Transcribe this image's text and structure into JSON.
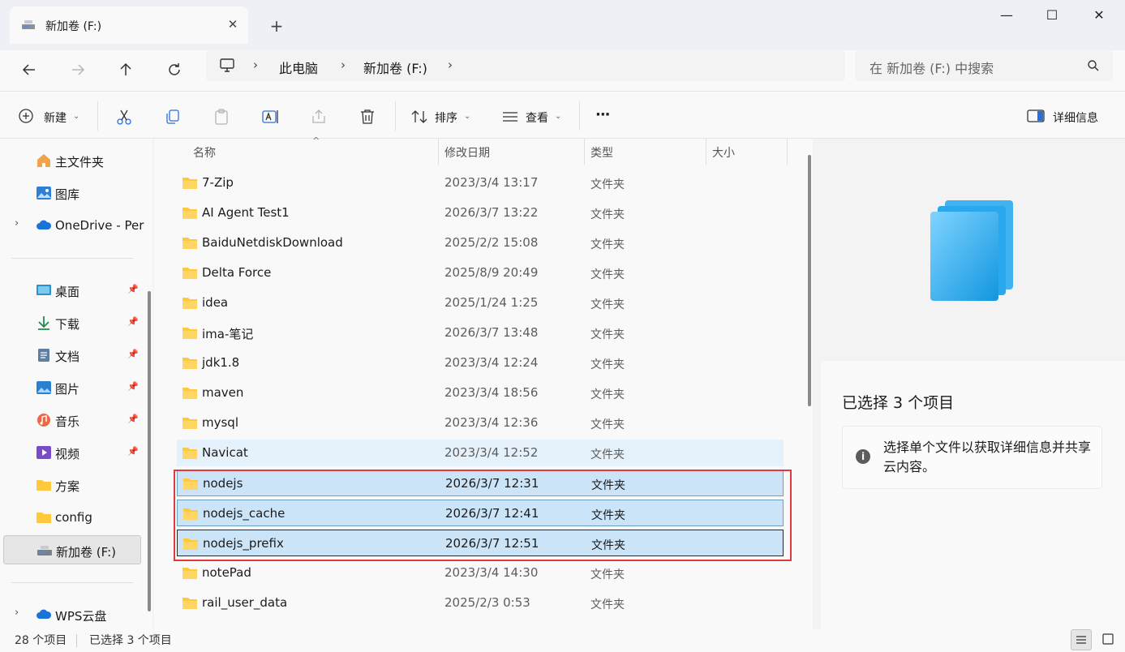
{
  "window": {
    "tab_title": "新加卷 (F:)",
    "close_glyph": "✕",
    "new_tab_glyph": "+",
    "minimize_glyph": "—",
    "maximize_glyph": "☐",
    "close_window_glyph": "✕"
  },
  "address": {
    "breadcrumb": [
      "此电脑",
      "新加卷 (F:)"
    ],
    "search_placeholder": "在 新加卷 (F:) 中搜索"
  },
  "toolbar": {
    "new_label": "新建",
    "sort_label": "排序",
    "view_label": "查看",
    "more_glyph": "···",
    "details_label": "详细信息"
  },
  "sidebar": {
    "items": [
      {
        "label": "主文件夹",
        "icon": "home-icon"
      },
      {
        "label": "图库",
        "icon": "gallery-icon"
      },
      {
        "label": "OneDrive - Per",
        "icon": "cloud-icon"
      },
      {
        "label": "桌面",
        "icon": "desktop-icon"
      },
      {
        "label": "下载",
        "icon": "download-icon"
      },
      {
        "label": "文档",
        "icon": "document-icon"
      },
      {
        "label": "图片",
        "icon": "pictures-icon"
      },
      {
        "label": "音乐",
        "icon": "music-icon"
      },
      {
        "label": "视频",
        "icon": "video-icon"
      },
      {
        "label": "方案",
        "icon": "folder-icon"
      },
      {
        "label": "config",
        "icon": "folder-icon"
      },
      {
        "label": "新加卷 (F:)",
        "icon": "drive-icon"
      },
      {
        "label": "WPS云盘",
        "icon": "cloud-icon"
      }
    ],
    "pin_glyph": "📌",
    "expand_glyph": "›"
  },
  "columns": {
    "name": "名称",
    "date": "修改日期",
    "type": "类型",
    "size": "大小"
  },
  "files": [
    {
      "name": "7-Zip",
      "date": "2023/3/4 13:17",
      "type": "文件夹"
    },
    {
      "name": "AI Agent Test1",
      "date": "2026/3/7 13:22",
      "type": "文件夹"
    },
    {
      "name": "BaiduNetdiskDownload",
      "date": "2025/2/2 15:08",
      "type": "文件夹"
    },
    {
      "name": "Delta Force",
      "date": "2025/8/9 20:49",
      "type": "文件夹"
    },
    {
      "name": "idea",
      "date": "2025/1/24 1:25",
      "type": "文件夹"
    },
    {
      "name": "ima-笔记",
      "date": "2026/3/7 13:48",
      "type": "文件夹"
    },
    {
      "name": "jdk1.8",
      "date": "2023/3/4 12:24",
      "type": "文件夹"
    },
    {
      "name": "maven",
      "date": "2023/3/4 18:56",
      "type": "文件夹"
    },
    {
      "name": "mysql",
      "date": "2023/3/4 12:36",
      "type": "文件夹"
    },
    {
      "name": "Navicat",
      "date": "2023/3/4 12:52",
      "type": "文件夹"
    },
    {
      "name": "nodejs",
      "date": "2026/3/7 12:31",
      "type": "文件夹"
    },
    {
      "name": "nodejs_cache",
      "date": "2026/3/7 12:41",
      "type": "文件夹"
    },
    {
      "name": "nodejs_prefix",
      "date": "2026/3/7 12:51",
      "type": "文件夹"
    },
    {
      "name": "notePad",
      "date": "2023/3/4 14:30",
      "type": "文件夹"
    },
    {
      "name": "rail_user_data",
      "date": "2025/2/3 0:53",
      "type": "文件夹"
    }
  ],
  "details": {
    "title": "已选择 3 个项目",
    "info_glyph": "i",
    "info_text": "选择单个文件以获取详细信息并共享云内容。"
  },
  "status": {
    "item_count": "28 个项目",
    "selected_count": "已选择 3 个项目"
  },
  "colors": {
    "selection": "#cce4f7",
    "highlight_box": "#e0393e",
    "folder": "#ffc83d"
  }
}
